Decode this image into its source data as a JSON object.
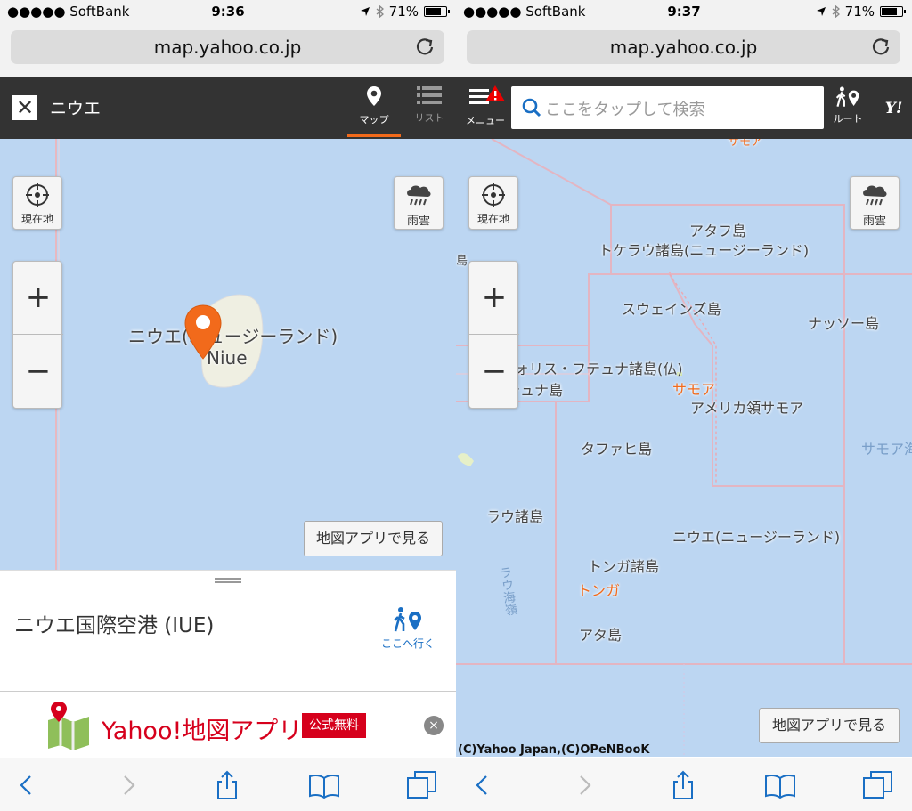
{
  "left": {
    "status": {
      "carrier": "●●●●● SoftBank",
      "time": "9:36",
      "battery_pct": "71%",
      "battery_level": 0.71
    },
    "url": "map.yahoo.co.jp",
    "header": {
      "title": "ニウエ",
      "tab_map": "マップ",
      "tab_list": "リスト"
    },
    "controls": {
      "current_location": "現在地",
      "rain": "雨雲",
      "zoom_in": "+",
      "zoom_out": "−"
    },
    "map_labels": {
      "country": "ニウエ(ニュージーランド)",
      "island": "Niue"
    },
    "open_in_app": "地図アプリで見る",
    "sheet": {
      "title": "ニウエ国際空港 (IUE)",
      "go_here": "ここへ行く"
    },
    "ad": {
      "title": "Yahoo!地図アプリ",
      "badge": "公式無料",
      "close": "×"
    },
    "colors": {
      "accent": "#f26a1b",
      "header_bg": "#333333",
      "map_water": "#bcd6f2",
      "ad_red": "#d6001c"
    }
  },
  "right": {
    "status": {
      "carrier": "●●●●● SoftBank",
      "time": "9:37",
      "battery_pct": "71%",
      "battery_level": 0.71
    },
    "url": "map.yahoo.co.jp",
    "header": {
      "menu": "メニュー",
      "search_placeholder": "ここをタップして検索",
      "route": "ルート",
      "yahoo_logo": "Y!"
    },
    "controls": {
      "current_location": "現在地",
      "rain": "雨雲",
      "zoom_in": "+",
      "zoom_out": "−"
    },
    "map_labels": {
      "atafu": "アタフ島",
      "tokelau": "トケラウ諸島(ニュージーランド)",
      "swains": "スウェインズ島",
      "nassau": "ナッソー島",
      "wallis": "ウォリス・フテュナ諸島(仏)",
      "futuna": "フテュナ島",
      "samoa": "サモア",
      "american_samoa": "アメリカ領サモア",
      "tafahi": "タファヒ島",
      "samoa_sea": "サモア海",
      "lau": "ラウ諸島",
      "niue": "ニウエ(ニュージーランド)",
      "tonga_islands": "トンガ諸島",
      "tonga": "トンガ",
      "ata": "アタ島",
      "lau_trench": "ラウ海嶺",
      "edge_top": "サモア",
      "edge_left": "島"
    },
    "open_in_app": "地図アプリで見る",
    "copyright": "(C)Yahoo Japan,(C)OPeNBooK"
  }
}
